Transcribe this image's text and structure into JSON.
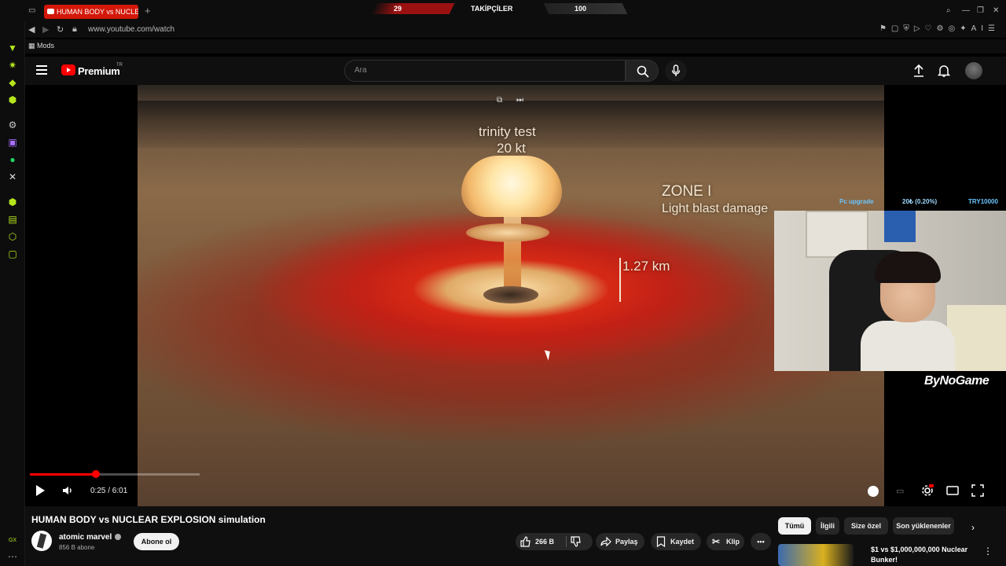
{
  "browser": {
    "tab_title": "HUMAN BODY vs NUCLEA",
    "url": "www.youtube.com/watch",
    "bookmark_label": "Mods",
    "gx_stats": {
      "left_value": "29",
      "label": "TAKİPÇİLER",
      "right_value": "100"
    }
  },
  "youtube": {
    "brand": "Premium",
    "region": "TR",
    "search_placeholder": "Ara"
  },
  "video": {
    "overlay_title": "trinity test",
    "overlay_yield": "20 kt",
    "zone_label": "ZONE I",
    "zone_desc": "Light blast damage",
    "distance": "1.27 km",
    "progress": 0.069
  },
  "stream_overlay": {
    "goal_label": "Pc upgrade",
    "goal_progress": "20₺ (0.20%)",
    "goal_target": "TRY10000",
    "watermark": "ByNoGame"
  },
  "player": {
    "time": "0:25 / 6:01"
  },
  "meta": {
    "title": "HUMAN BODY vs NUCLEAR EXPLOSION simulation",
    "channel": "atomic marvel",
    "subscribers": "856 B abone",
    "subscribe_label": "Abone ol",
    "likes": "266 B",
    "share_label": "Paylaş",
    "save_label": "Kaydet",
    "clip_label": "Klip"
  },
  "chips": [
    "Tümü",
    "İlgili",
    "Size özel",
    "Son yüklenenler"
  ],
  "recommendation": {
    "title": "$1 vs $1,000,000,000 Nuclear Bunker!"
  }
}
